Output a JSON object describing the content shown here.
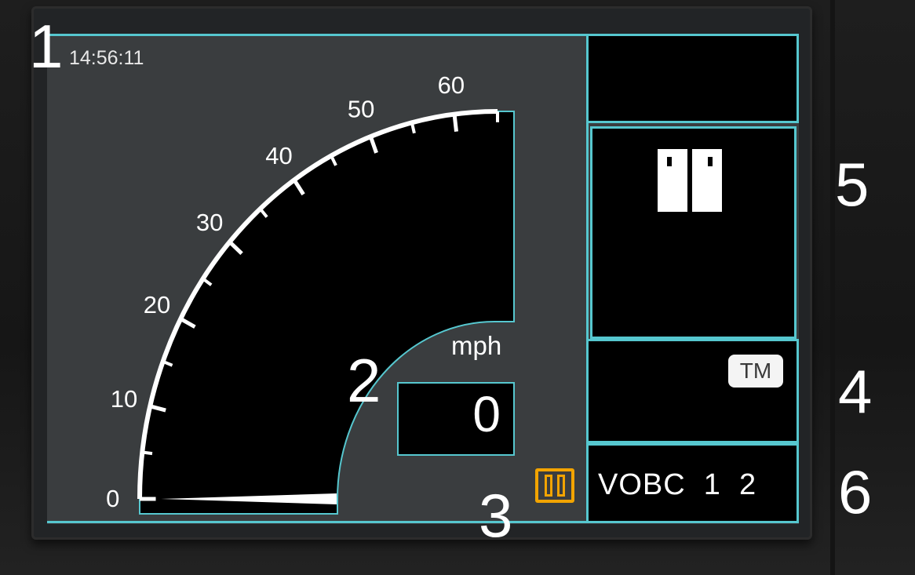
{
  "callouts": {
    "one": "1",
    "two": "2",
    "three": "3",
    "four": "4",
    "five": "5",
    "six": "6"
  },
  "clock": {
    "time": "14:56:11"
  },
  "speedometer": {
    "unit": "mph",
    "current_speed": "0",
    "scale_labels": [
      "0",
      "10",
      "20",
      "30",
      "40",
      "50",
      "60"
    ],
    "max_speed": 65,
    "needle_value": 0
  },
  "status": {
    "mode_badge": "TM",
    "vobc_text": "VOBC  1  2"
  },
  "icons": {
    "door_icon": "train-doors-icon",
    "indicator_icon": "train-doors-outline-icon"
  },
  "colors": {
    "frame": "#56c7cf",
    "indicator": "#f2a400",
    "display_bg": "#3a3d3f"
  }
}
